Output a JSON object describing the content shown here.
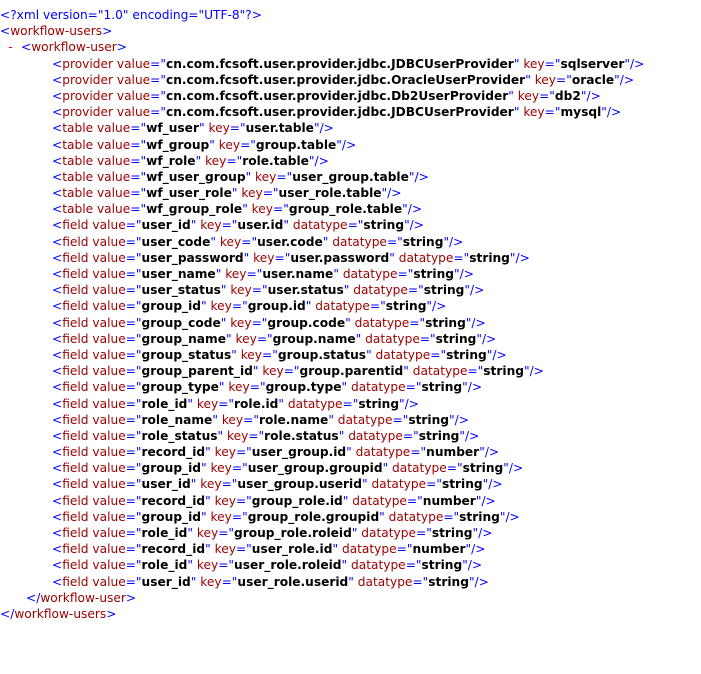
{
  "declaration": "<?xml version=\"1.0\" encoding=\"UTF-8\"?>",
  "root_tag": "workflow-users",
  "child_tag": "workflow-user",
  "collapse_toggle": "-",
  "colors": {
    "markup": "#0000ff",
    "name": "#990000",
    "value": "#000000",
    "toggle": "#ff0000"
  },
  "elements": [
    {
      "tag": "provider",
      "attrs": [
        [
          "value",
          "cn.com.fcsoft.user.provider.jdbc.JDBCUserProvider"
        ],
        [
          "key",
          "sqlserver"
        ]
      ]
    },
    {
      "tag": "provider",
      "attrs": [
        [
          "value",
          "cn.com.fcsoft.user.provider.jdbc.OracleUserProvider"
        ],
        [
          "key",
          "oracle"
        ]
      ]
    },
    {
      "tag": "provider",
      "attrs": [
        [
          "value",
          "cn.com.fcsoft.user.provider.jdbc.Db2UserProvider"
        ],
        [
          "key",
          "db2"
        ]
      ]
    },
    {
      "tag": "provider",
      "attrs": [
        [
          "value",
          "cn.com.fcsoft.user.provider.jdbc.JDBCUserProvider"
        ],
        [
          "key",
          "mysql"
        ]
      ]
    },
    {
      "tag": "table",
      "attrs": [
        [
          "value",
          "wf_user"
        ],
        [
          "key",
          "user.table"
        ]
      ]
    },
    {
      "tag": "table",
      "attrs": [
        [
          "value",
          "wf_group"
        ],
        [
          "key",
          "group.table"
        ]
      ]
    },
    {
      "tag": "table",
      "attrs": [
        [
          "value",
          "wf_role"
        ],
        [
          "key",
          "role.table"
        ]
      ]
    },
    {
      "tag": "table",
      "attrs": [
        [
          "value",
          "wf_user_group"
        ],
        [
          "key",
          "user_group.table"
        ]
      ]
    },
    {
      "tag": "table",
      "attrs": [
        [
          "value",
          "wf_user_role"
        ],
        [
          "key",
          "user_role.table"
        ]
      ]
    },
    {
      "tag": "table",
      "attrs": [
        [
          "value",
          "wf_group_role"
        ],
        [
          "key",
          "group_role.table"
        ]
      ]
    },
    {
      "tag": "field",
      "attrs": [
        [
          "value",
          "user_id"
        ],
        [
          "key",
          "user.id"
        ],
        [
          "datatype",
          "string"
        ]
      ]
    },
    {
      "tag": "field",
      "attrs": [
        [
          "value",
          "user_code"
        ],
        [
          "key",
          "user.code"
        ],
        [
          "datatype",
          "string"
        ]
      ]
    },
    {
      "tag": "field",
      "attrs": [
        [
          "value",
          "user_password"
        ],
        [
          "key",
          "user.password"
        ],
        [
          "datatype",
          "string"
        ]
      ]
    },
    {
      "tag": "field",
      "attrs": [
        [
          "value",
          "user_name"
        ],
        [
          "key",
          "user.name"
        ],
        [
          "datatype",
          "string"
        ]
      ]
    },
    {
      "tag": "field",
      "attrs": [
        [
          "value",
          "user_status"
        ],
        [
          "key",
          "user.status"
        ],
        [
          "datatype",
          "string"
        ]
      ]
    },
    {
      "tag": "field",
      "attrs": [
        [
          "value",
          "group_id"
        ],
        [
          "key",
          "group.id"
        ],
        [
          "datatype",
          "string"
        ]
      ]
    },
    {
      "tag": "field",
      "attrs": [
        [
          "value",
          "group_code"
        ],
        [
          "key",
          "group.code"
        ],
        [
          "datatype",
          "string"
        ]
      ]
    },
    {
      "tag": "field",
      "attrs": [
        [
          "value",
          "group_name"
        ],
        [
          "key",
          "group.name"
        ],
        [
          "datatype",
          "string"
        ]
      ]
    },
    {
      "tag": "field",
      "attrs": [
        [
          "value",
          "group_status"
        ],
        [
          "key",
          "group.status"
        ],
        [
          "datatype",
          "string"
        ]
      ]
    },
    {
      "tag": "field",
      "attrs": [
        [
          "value",
          "group_parent_id"
        ],
        [
          "key",
          "group.parentid"
        ],
        [
          "datatype",
          "string"
        ]
      ]
    },
    {
      "tag": "field",
      "attrs": [
        [
          "value",
          "group_type"
        ],
        [
          "key",
          "group.type"
        ],
        [
          "datatype",
          "string"
        ]
      ]
    },
    {
      "tag": "field",
      "attrs": [
        [
          "value",
          "role_id"
        ],
        [
          "key",
          "role.id"
        ],
        [
          "datatype",
          "string"
        ]
      ]
    },
    {
      "tag": "field",
      "attrs": [
        [
          "value",
          "role_name"
        ],
        [
          "key",
          "role.name"
        ],
        [
          "datatype",
          "string"
        ]
      ]
    },
    {
      "tag": "field",
      "attrs": [
        [
          "value",
          "role_status"
        ],
        [
          "key",
          "role.status"
        ],
        [
          "datatype",
          "string"
        ]
      ]
    },
    {
      "tag": "field",
      "attrs": [
        [
          "value",
          "record_id"
        ],
        [
          "key",
          "user_group.id"
        ],
        [
          "datatype",
          "number"
        ]
      ]
    },
    {
      "tag": "field",
      "attrs": [
        [
          "value",
          "group_id"
        ],
        [
          "key",
          "user_group.groupid"
        ],
        [
          "datatype",
          "string"
        ]
      ]
    },
    {
      "tag": "field",
      "attrs": [
        [
          "value",
          "user_id"
        ],
        [
          "key",
          "user_group.userid"
        ],
        [
          "datatype",
          "string"
        ]
      ]
    },
    {
      "tag": "field",
      "attrs": [
        [
          "value",
          "record_id"
        ],
        [
          "key",
          "group_role.id"
        ],
        [
          "datatype",
          "number"
        ]
      ]
    },
    {
      "tag": "field",
      "attrs": [
        [
          "value",
          "group_id"
        ],
        [
          "key",
          "group_role.groupid"
        ],
        [
          "datatype",
          "string"
        ]
      ]
    },
    {
      "tag": "field",
      "attrs": [
        [
          "value",
          "role_id"
        ],
        [
          "key",
          "group_role.roleid"
        ],
        [
          "datatype",
          "string"
        ]
      ]
    },
    {
      "tag": "field",
      "attrs": [
        [
          "value",
          "record_id"
        ],
        [
          "key",
          "user_role.id"
        ],
        [
          "datatype",
          "number"
        ]
      ]
    },
    {
      "tag": "field",
      "attrs": [
        [
          "value",
          "role_id"
        ],
        [
          "key",
          "user_role.roleid"
        ],
        [
          "datatype",
          "string"
        ]
      ]
    },
    {
      "tag": "field",
      "attrs": [
        [
          "value",
          "user_id"
        ],
        [
          "key",
          "user_role.userid"
        ],
        [
          "datatype",
          "string"
        ]
      ]
    }
  ]
}
